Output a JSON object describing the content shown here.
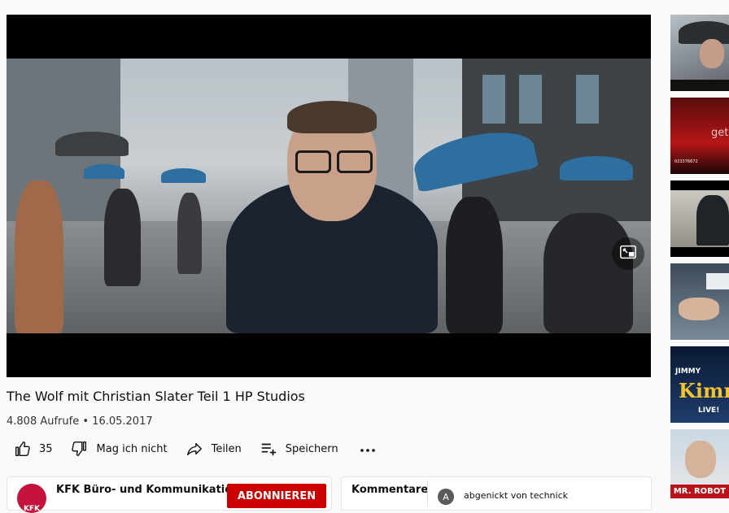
{
  "video": {
    "title": "The Wolf mit Christian Slater Teil 1 HP Studios",
    "views": "4.808 Aufrufe",
    "separator": "•",
    "date": "16.05.2017"
  },
  "actions": {
    "likes": "35",
    "dislike_label": "Mag ich nicht",
    "share_label": "Teilen",
    "save_label": "Speichern"
  },
  "channel": {
    "name": "KFK Büro- und Kommunikatio…",
    "avatar_text": "KFK",
    "subscribe_label": "ABONNIEREN"
  },
  "comments": {
    "label": "Kommentare",
    "first_author": "abgenickt von technick",
    "first_avatar": "A"
  },
  "sidebar": {
    "thumbs": [
      {
        "caption": ""
      },
      {
        "caption": "023376672"
      },
      {
        "caption": ""
      },
      {
        "caption": ""
      },
      {
        "caption": "JIMMY"
      },
      {
        "caption": "MR. ROBOT"
      }
    ]
  },
  "colors": {
    "subscribe": "#cc0000",
    "avatar": "#c4143c",
    "umbrella_blue": "#2e6f9f"
  },
  "icons": [
    "miniplayer-icon",
    "thumb-up-icon",
    "thumb-down-icon",
    "share-icon",
    "save-playlist-icon",
    "more-icon"
  ]
}
